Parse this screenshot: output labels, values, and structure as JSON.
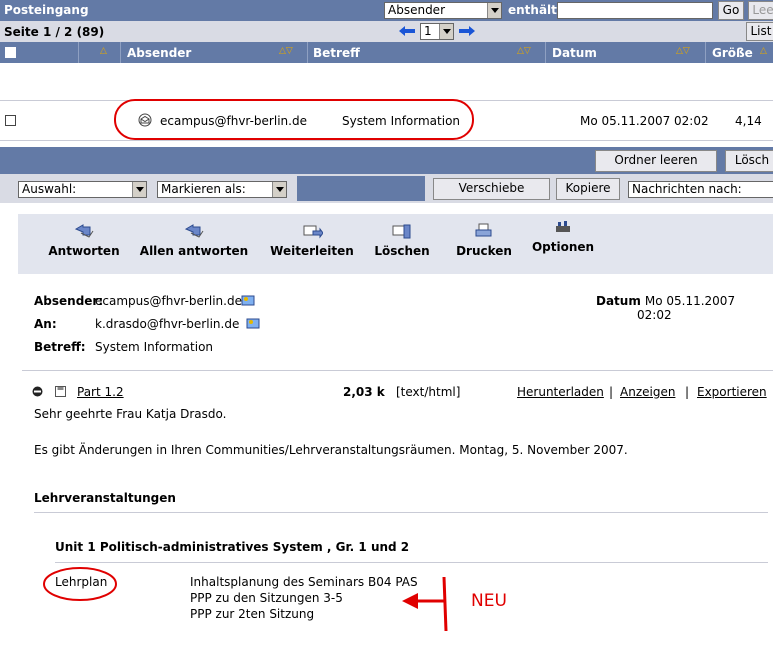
{
  "header": {
    "title": "Posteingang",
    "filter_field": "Absender",
    "filter_op": "enthält",
    "go": "Go",
    "empty": "Lee"
  },
  "pager": {
    "page_info": "Seite 1 / 2 (89)",
    "current_page": "1",
    "view": "List"
  },
  "columns": {
    "sender": "Absender",
    "subject": "Betreff",
    "date": "Datum",
    "size": "Größe"
  },
  "message_row": {
    "sender": "ecampus@fhvr-berlin.de",
    "subject": "System Information",
    "date": "Mo 05.11.2007 02:02",
    "size": "4,14"
  },
  "folder_actions": {
    "empty_folder": "Ordner leeren",
    "delete": "Lösch"
  },
  "actions_bar": {
    "selection": "Auswahl:",
    "mark_as": "Markieren als:",
    "move": "Verschiebe",
    "copy": "Kopiere",
    "messages_to": "Nachrichten nach:"
  },
  "toolbar": {
    "reply": "Antworten",
    "reply_all": "Allen antworten",
    "forward": "Weiterleiten",
    "delete": "Löschen",
    "print": "Drucken",
    "options": "Optionen"
  },
  "message_header": {
    "from_label": "Absender:",
    "from": "ecampus@fhvr-berlin.de",
    "to_label": "An:",
    "to": "k.drasdo@fhvr-berlin.de",
    "subject_label": "Betreff:",
    "subject": "System Information",
    "date_label": "Datum",
    "date": ": Mo 05.11.2007 02:02"
  },
  "part": {
    "name": "Part 1.2",
    "size": "2,03 k",
    "type": "[text/html]",
    "download": "Herunterladen",
    "sep": "|",
    "show": "Anzeigen",
    "export": "Exportieren"
  },
  "body": {
    "greeting": "Sehr geehrte Frau Katja Drasdo.",
    "intro": "Es gibt Änderungen in Ihren Communities/Lehrveranstaltungsräumen. Montag, 5. November 2007.",
    "section": "Lehrveranstaltungen",
    "course": "Unit 1 Politisch-administratives System , Gr. 1 und 2",
    "item_label": "Lehrplan",
    "items": [
      "Inhaltsplanung des Seminars B04 PAS",
      "PPP zu den Sitzungen 3-5",
      "PPP zur 2ten Sitzung"
    ]
  },
  "annotation": {
    "new_label": "NEU",
    "color": "#e00000"
  }
}
